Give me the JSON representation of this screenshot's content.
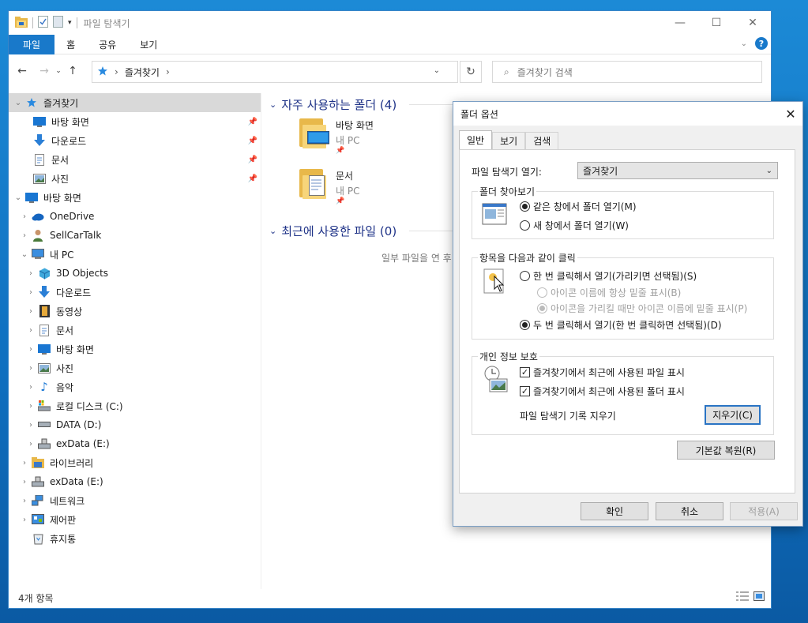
{
  "window": {
    "title": "파일 탐색기",
    "controls": {
      "minimize": "—",
      "maximize": "☐",
      "close": "✕"
    }
  },
  "ribbon": {
    "tabs": [
      "파일",
      "홈",
      "공유",
      "보기"
    ],
    "help": "?"
  },
  "address": {
    "path": [
      "즐겨찾기"
    ],
    "separator": "›"
  },
  "search": {
    "placeholder": "즐겨찾기 검색"
  },
  "sidebar": {
    "items": [
      {
        "label": "즐겨찾기"
      },
      {
        "label": "바탕 화면"
      },
      {
        "label": "다운로드"
      },
      {
        "label": "문서"
      },
      {
        "label": "사진"
      },
      {
        "label": "바탕 화면"
      },
      {
        "label": "OneDrive"
      },
      {
        "label": "SellCarTalk"
      },
      {
        "label": "내 PC"
      },
      {
        "label": "3D Objects"
      },
      {
        "label": "다운로드"
      },
      {
        "label": "동영상"
      },
      {
        "label": "문서"
      },
      {
        "label": "바탕 화면"
      },
      {
        "label": "사진"
      },
      {
        "label": "음악"
      },
      {
        "label": "로컬 디스크 (C:)"
      },
      {
        "label": "DATA (D:)"
      },
      {
        "label": "exData (E:)"
      },
      {
        "label": "라이브러리"
      },
      {
        "label": "exData (E:)"
      },
      {
        "label": "네트워크"
      },
      {
        "label": "제어판"
      },
      {
        "label": "휴지통"
      }
    ]
  },
  "content": {
    "frequent_header": "자주 사용하는 폴더 (4)",
    "frequent": [
      {
        "name": "바탕 화면",
        "location": "내 PC"
      },
      {
        "name": "문서",
        "location": "내 PC"
      }
    ],
    "recent_header": "최근에 사용한 파일 (0)",
    "recent_empty": "일부 파일을 연 후"
  },
  "status": {
    "count": "4개 항목"
  },
  "dialog": {
    "title": "폴더 옵션",
    "tabs": [
      "일반",
      "보기",
      "검색"
    ],
    "open_label": "파일 탐색기 열기:",
    "open_value": "즐겨찾기",
    "browse": {
      "legend": "폴더 찾아보기",
      "same_window": "같은 창에서 폴더 열기(M)",
      "new_window": "새 창에서 폴더 열기(W)"
    },
    "click": {
      "legend": "항목을 다음과 같이 클릭",
      "single": "한 번 클릭해서 열기(가리키면 선택됨)(S)",
      "underline_always": "아이콘 이름에 항상 밑줄 표시(B)",
      "underline_hover": "아이콘을 가리킬 때만 아이콘 이름에 밑줄 표시(P)",
      "double": "두 번 클릭해서 열기(한 번 클릭하면 선택됨)(D)"
    },
    "privacy": {
      "legend": "개인 정보 보호",
      "recent_files": "즐겨찾기에서 최근에 사용된 파일 표시",
      "recent_folders": "즐겨찾기에서 최근에 사용된 폴더 표시",
      "clear_label": "파일 탐색기 기록 지우기",
      "clear_button": "지우기(C)"
    },
    "restore": "기본값 복원(R)",
    "ok": "확인",
    "cancel": "취소",
    "apply": "적용(A)"
  }
}
